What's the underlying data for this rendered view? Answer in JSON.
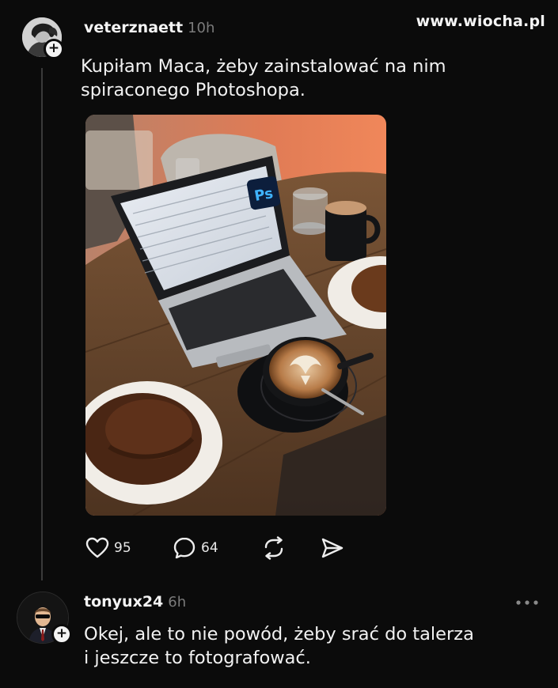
{
  "watermark": "www.wiocha.pl",
  "post": {
    "username": "veterznaett",
    "time": "10h",
    "text": "Kupiłam Maca, żeby zainstalować na nim\nspiraconego Photoshopa.",
    "photo_badge": "Ps",
    "actions": {
      "likes": "95",
      "comments": "64"
    }
  },
  "reply": {
    "username": "tonyux24",
    "time": "6h",
    "text": "Okej, ale to nie powód, żeby srać do talerza\ni jeszcze to fotografować."
  },
  "icons": {
    "like": "heart-icon",
    "comment": "speech-bubble-icon",
    "repost": "repost-icon",
    "share": "send-icon",
    "more": "more-horizontal-icon",
    "follow": "plus-icon"
  },
  "colors": {
    "background": "#0b0b0b",
    "text": "#f2f2f2",
    "muted": "#7b7b7b",
    "thread_line": "#3a3a3a"
  }
}
